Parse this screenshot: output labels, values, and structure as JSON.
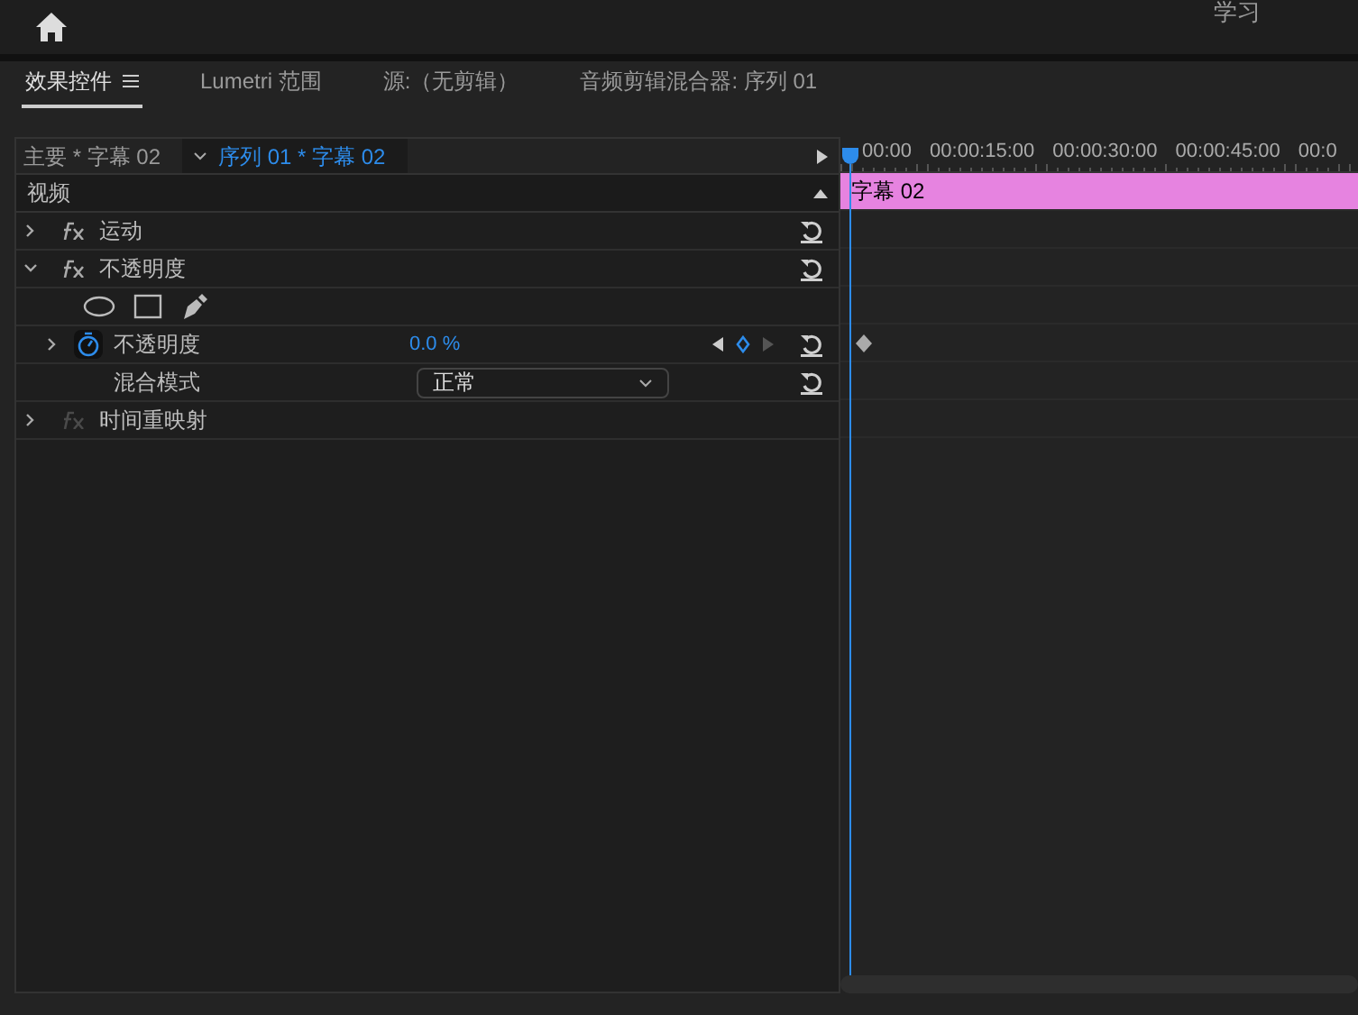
{
  "top_bar": {
    "workspace_tabs": [
      "学习"
    ]
  },
  "panel_tabs": [
    {
      "label": "效果控件",
      "selected": true,
      "has_menu": true
    },
    {
      "label": "Lumetri 范围",
      "selected": false,
      "has_menu": false
    },
    {
      "label": "源:（无剪辑）",
      "selected": false,
      "has_menu": false
    },
    {
      "label": "音频剪辑混合器: 序列 01",
      "selected": false,
      "has_menu": false
    }
  ],
  "clip_header": {
    "master": "主要 * 字幕 02",
    "sequence_clip": "序列 01 * 字幕 02"
  },
  "section": "视频",
  "effects": [
    {
      "kind": "effect",
      "name": "运动",
      "expanded": false,
      "enabled": true
    },
    {
      "kind": "effect",
      "name": "不透明度",
      "expanded": true,
      "enabled": true
    },
    {
      "kind": "masks"
    },
    {
      "kind": "param",
      "name": "不透明度",
      "value": "0.0 %",
      "animated": true
    },
    {
      "kind": "dropdown",
      "name": "混合模式",
      "value": "正常"
    },
    {
      "kind": "effect",
      "name": "时间重映射",
      "expanded": false,
      "enabled": false
    }
  ],
  "timeline": {
    "ruler": [
      "00:00",
      "00:00:15:00",
      "00:00:30:00",
      "00:00:45:00",
      "00:0"
    ],
    "clip": "字幕 02"
  }
}
